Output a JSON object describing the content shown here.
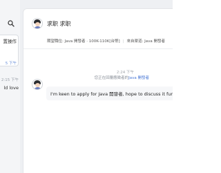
{
  "sidebar": {
    "active_item": {
      "title": "置操作",
      "time": "5 下午"
    },
    "item_2": {
      "time": "2:15 下午",
      "preview": "ld love"
    }
  },
  "chat": {
    "name": "求职 求职",
    "job": {
      "salary": "期望職位: Java 開發者 · 100K-110K[台幣]",
      "channel": "來自渠道: Java 開發者"
    },
    "timestamp": "2:24 下午",
    "notice": {
      "prefix": "您正在回覆應徵者的",
      "link": "Java 開發者"
    },
    "messages": [
      {
        "text": "I'm keen to apply for Java 開發者, hope to discuss it further"
      }
    ]
  },
  "colors": {
    "link": "#4a78d6",
    "background": "#eef0f3"
  },
  "icons": [
    "search-icon",
    "avatar"
  ]
}
